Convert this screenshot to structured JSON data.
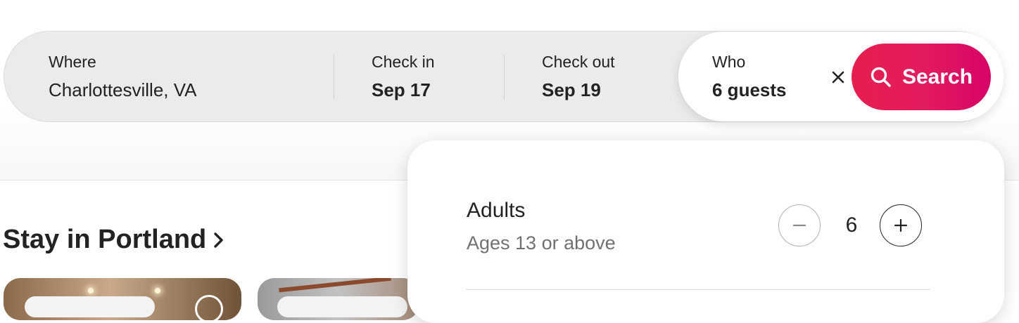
{
  "search": {
    "where": {
      "label": "Where",
      "value": "Charlottesville, VA"
    },
    "check_in": {
      "label": "Check in",
      "value": "Sep 17"
    },
    "check_out": {
      "label": "Check out",
      "value": "Sep 19"
    },
    "who": {
      "label": "Who",
      "value": "6 guests"
    },
    "clear_icon": "close-icon",
    "search_button": {
      "label": "Search",
      "icon": "search-icon"
    }
  },
  "section": {
    "title": "Stay in Portland",
    "chevron_icon": "chevron-right-icon"
  },
  "guests": {
    "rows": [
      {
        "title": "Adults",
        "subtitle": "Ages 13 or above",
        "count": "6"
      }
    ]
  },
  "colors": {
    "brand": "#e31c5f",
    "text": "#222222",
    "muted": "#717171"
  }
}
